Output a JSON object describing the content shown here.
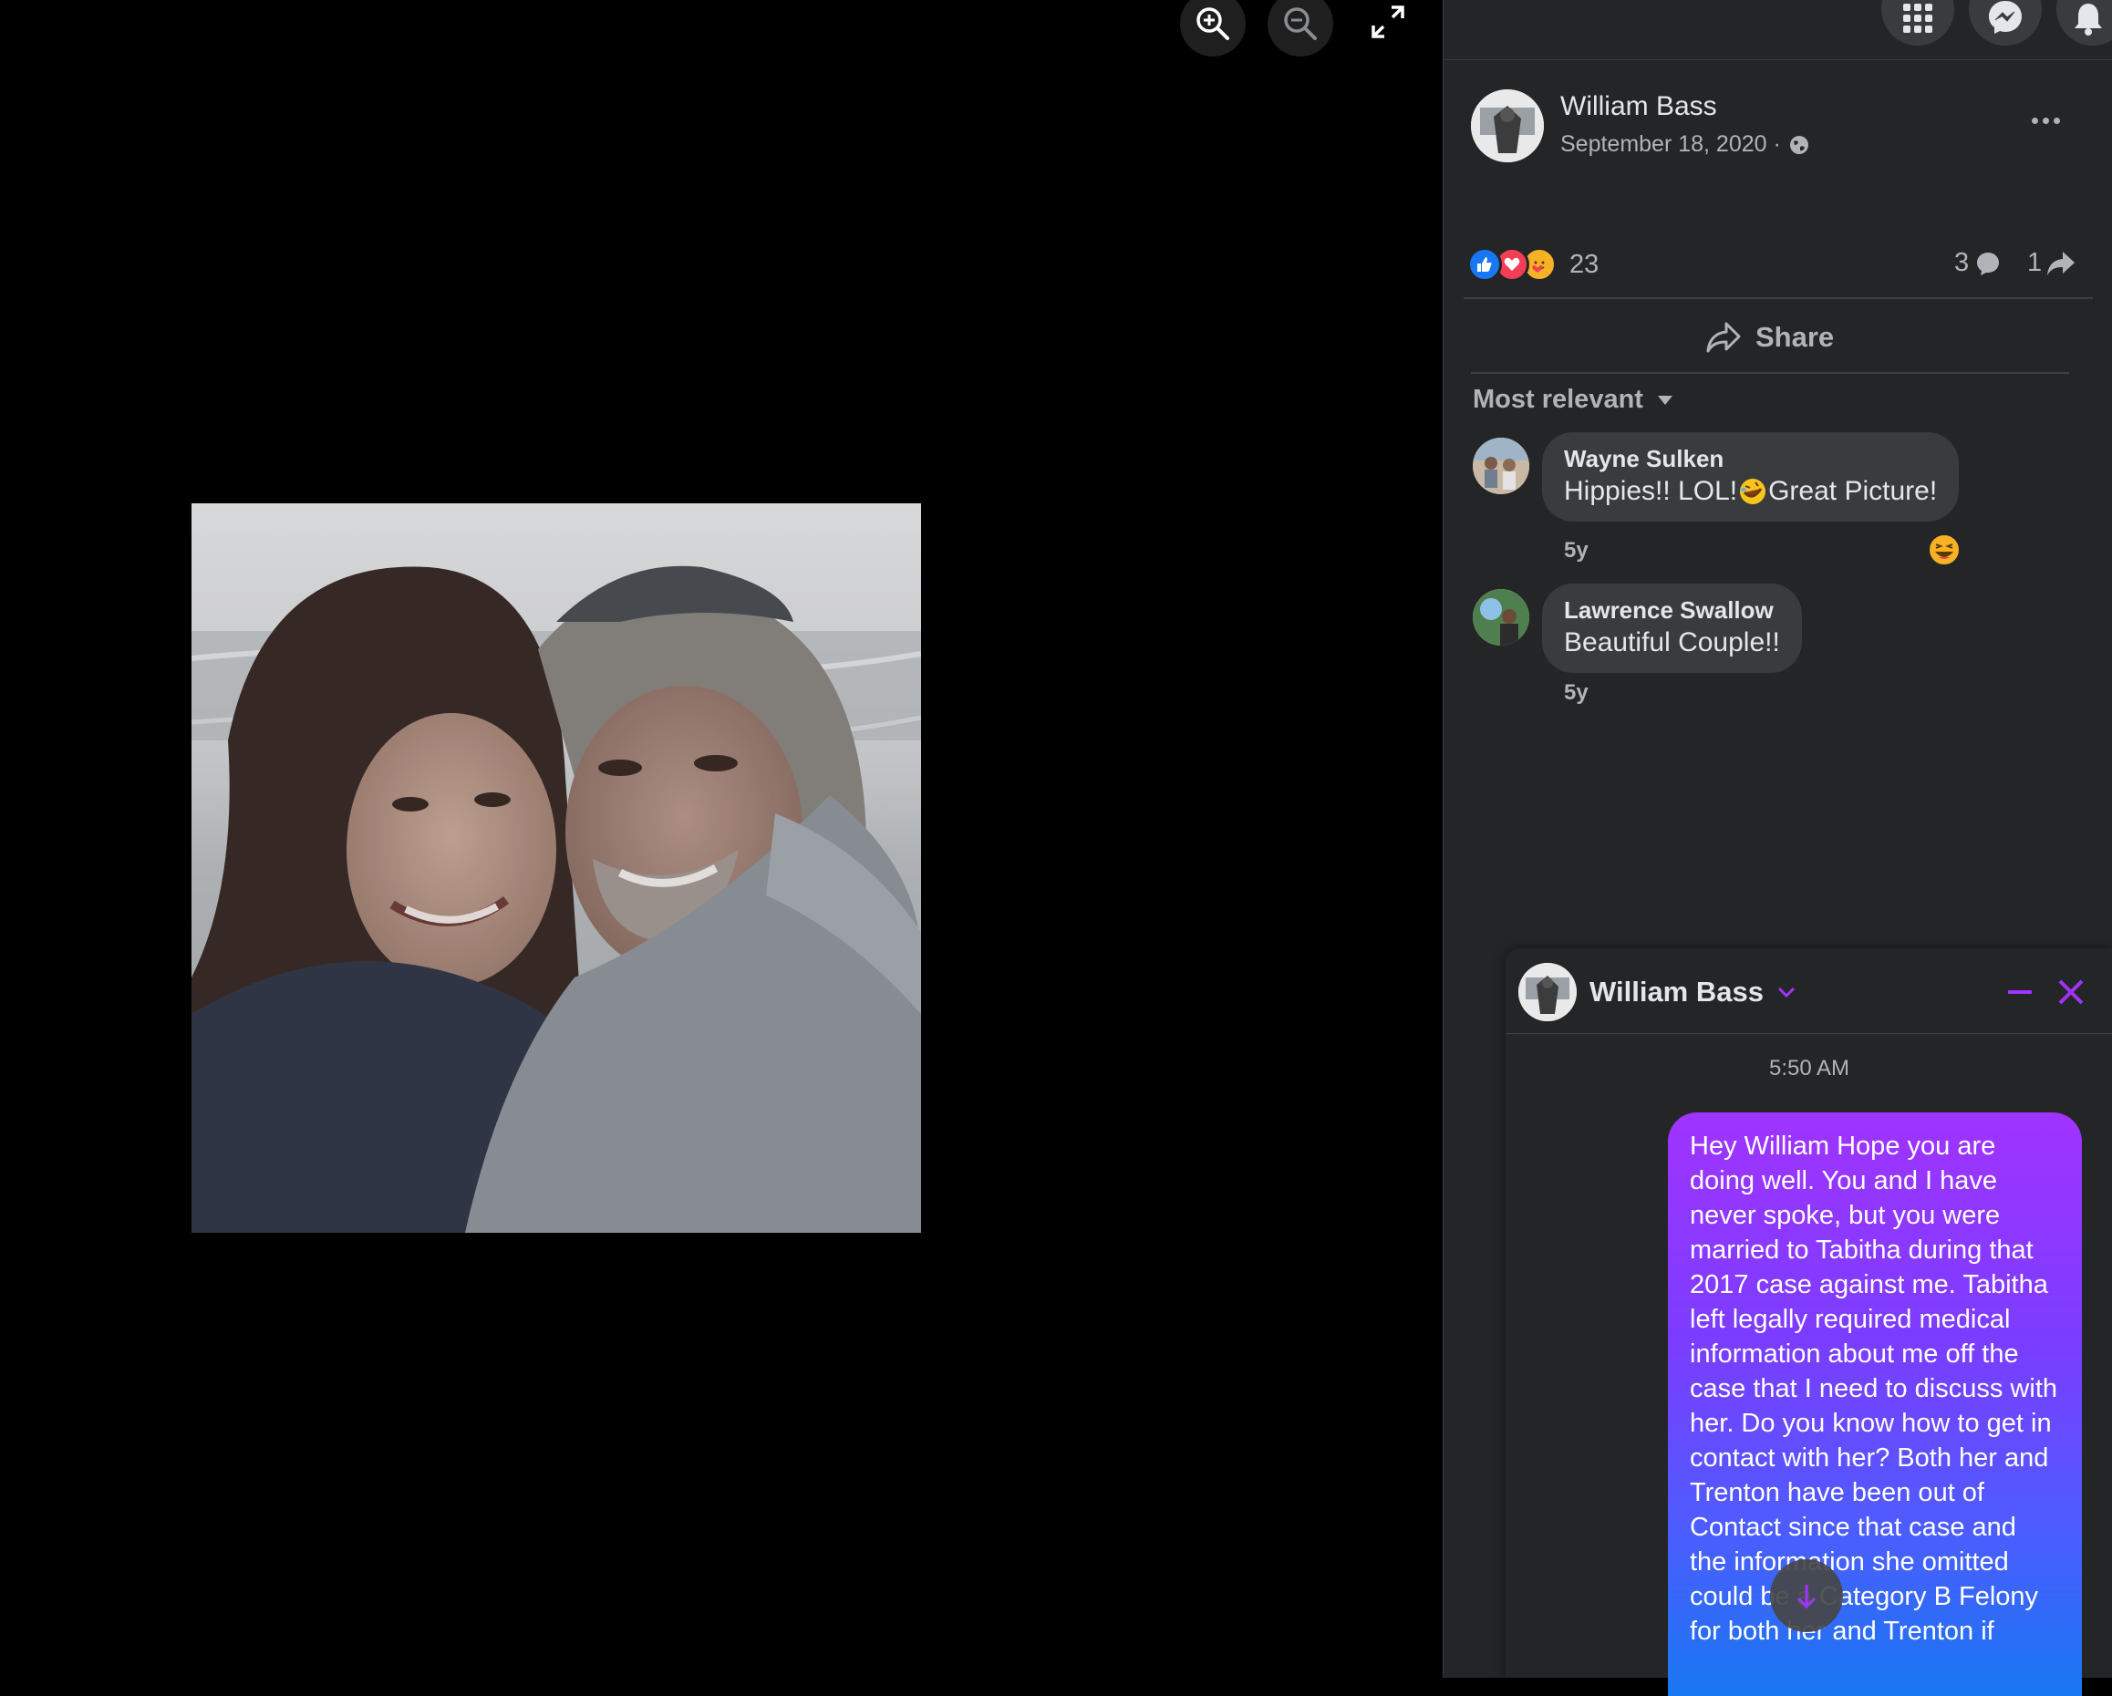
{
  "post": {
    "author": "William Bass",
    "date": "September 18, 2020 ·",
    "reaction_count": "23",
    "comment_count": "3",
    "share_count": "1",
    "share_label": "Share",
    "sort_label": "Most relevant"
  },
  "comments": [
    {
      "name": "Wayne Sulken",
      "text_before": "Hippies!! LOL!",
      "text_after": "Great Picture!",
      "time": "5y"
    },
    {
      "name": "Lawrence Swallow",
      "text": "Beautiful Couple!!",
      "time": "5y"
    }
  ],
  "chat": {
    "name": "William Bass",
    "timestamp": "5:50 AM",
    "message": "Hey William Hope you are doing well. You and I have never spoke, but you were married to Tabitha during that 2017 case against me. Tabitha left legally required medical information about me off the case that I need to discuss with her. Do you know how to get in contact with her? Both her and Trenton have been out of Contact since that case and the information she omitted could be a Category B Felony for both her and Trenton if"
  },
  "colors": {
    "background": "#000000",
    "panel": "#242526",
    "bubble": "#3a3b3c",
    "accent_purple": "#a033ff",
    "like_blue": "#1877f2",
    "love_red": "#f33e58"
  },
  "icons": [
    "zoom-in-icon",
    "zoom-out-icon",
    "fullscreen-icon",
    "apps-grid-icon",
    "messenger-icon",
    "bell-icon",
    "globe-icon",
    "more-icon",
    "like-icon",
    "love-icon",
    "care-icon",
    "comment-icon",
    "share-icon",
    "caret-down-icon",
    "minimize-icon",
    "close-icon",
    "arrow-down-icon"
  ]
}
